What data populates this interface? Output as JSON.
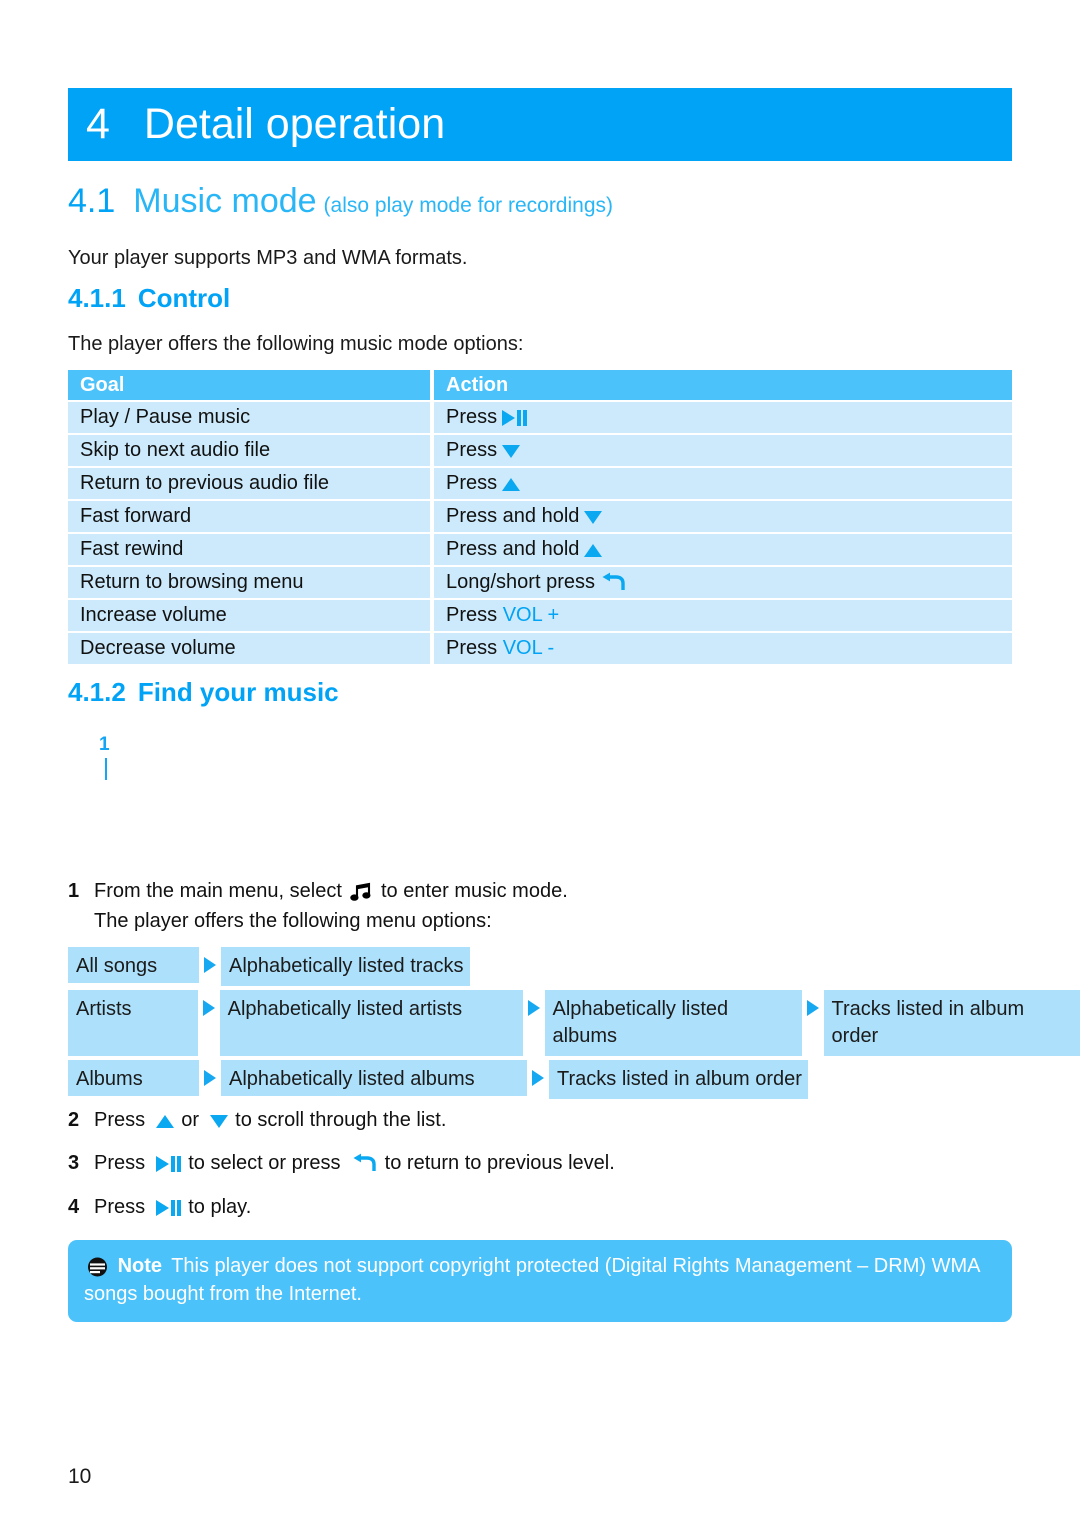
{
  "chapter": {
    "number": "4",
    "title": "Detail operation"
  },
  "section": {
    "number": "4.1",
    "title": "Music mode",
    "subtitle": "(also play mode for recordings)",
    "intro": "Your player supports MP3 and WMA formats."
  },
  "control": {
    "number": "4.1.1",
    "title": "Control",
    "intro": "The player offers the following music mode options:",
    "columns": [
      "Goal",
      "Action"
    ],
    "rows": [
      {
        "goal": "Play / Pause music",
        "action_prefix": "Press",
        "icon": "play-pause-icon",
        "action_suffix": ""
      },
      {
        "goal": "Skip to next audio file",
        "action_prefix": "Press",
        "icon": "down-arrow-icon",
        "action_suffix": ""
      },
      {
        "goal": "Return to previous audio file",
        "action_prefix": "Press",
        "icon": "up-arrow-icon",
        "action_suffix": ""
      },
      {
        "goal": "Fast forward",
        "action_prefix": "Press and hold",
        "icon": "down-arrow-icon",
        "action_suffix": ""
      },
      {
        "goal": "Fast rewind",
        "action_prefix": "Press and hold",
        "icon": "up-arrow-icon",
        "action_suffix": ""
      },
      {
        "goal": "Return to browsing menu",
        "action_prefix": "Long/short press",
        "icon": "back-arrow-icon",
        "action_suffix": ""
      },
      {
        "goal": "Increase volume",
        "action_prefix": "Press",
        "icon": "none",
        "action_suffix": "VOL +"
      },
      {
        "goal": "Decrease volume",
        "action_prefix": "Press",
        "icon": "none",
        "action_suffix": "VOL -"
      }
    ]
  },
  "find": {
    "number": "4.1.2",
    "title": "Find your music",
    "callout_marker": "1",
    "steps": [
      {
        "num": "1",
        "line1_before": "From the main menu, select",
        "line1_icon": "music-note-icon",
        "line1_after": "to enter music mode.",
        "line2": "The player offers the following menu options:"
      },
      {
        "num": "2",
        "before": "Press",
        "icon1": "up-arrow-icon",
        "middle": "or",
        "icon2": "down-arrow-icon",
        "after": "to scroll through the list."
      },
      {
        "num": "3",
        "before": "Press",
        "icon1": "play-pause-icon",
        "middle": "to select or press",
        "icon2": "back-arrow-icon",
        "after": "to return to previous level."
      },
      {
        "num": "4",
        "before": "Press",
        "icon1": "play-pause-icon",
        "after": "to play."
      }
    ],
    "menu_flow": [
      [
        "All songs",
        "Alphabetically listed tracks"
      ],
      [
        "Artists",
        "Alphabetically listed artists",
        "Alphabetically listed albums",
        "Tracks listed in album order"
      ],
      [
        "Albums",
        "Alphabetically listed albums",
        "Tracks listed in album order"
      ]
    ]
  },
  "note": {
    "icon": "note-info-icon",
    "label": "Note",
    "text": "This player does not support copyright protected (Digital Rights Management – DRM) WMA songs bought from the Internet."
  },
  "footer": {
    "page_number": "10"
  },
  "colors": {
    "brand_blue": "#00a3f5",
    "header_blue": "#4cc2fb",
    "row_blue": "#cceafb",
    "box_blue": "#ace0fb",
    "white": "#ffffff"
  }
}
